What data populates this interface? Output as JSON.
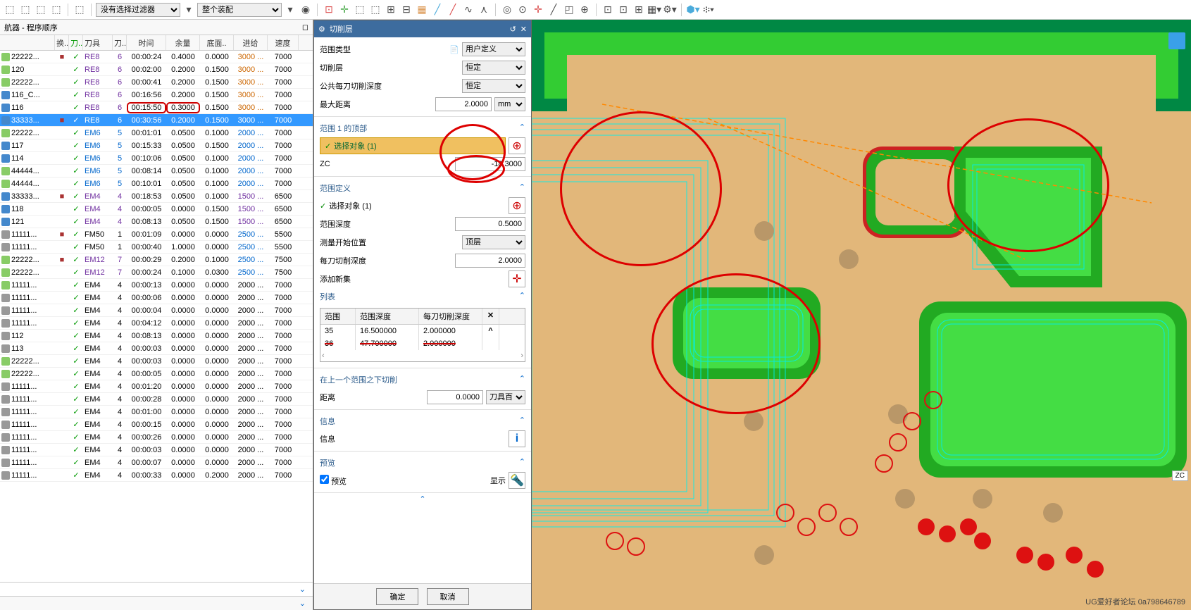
{
  "toolbar": {
    "filter1": "没有选择过滤器",
    "filter2": "整个装配"
  },
  "nav": {
    "title": "航器 - 程序顺序",
    "cols": {
      "name": "",
      "huan": "换..",
      "dao": "刀..",
      "tool": "刀具",
      "d": "刀..",
      "time": "时间",
      "yl": "余量",
      "dm": "底面..",
      "feed": "进给",
      "speed": "速度"
    },
    "rows": [
      {
        "ic": "op1",
        "name": "22222...",
        "huan": "■",
        "tool": "RE8",
        "d": "6",
        "time": "00:00:24",
        "yl": "0.4000",
        "dm": "0.0000",
        "feed": "3000 ...",
        "speed": "7000",
        "tc": "purple",
        "fc": "orange"
      },
      {
        "ic": "op1",
        "name": "120",
        "tool": "RE8",
        "d": "6",
        "time": "00:02:00",
        "yl": "0.2000",
        "dm": "0.1500",
        "feed": "3000 ...",
        "speed": "7000",
        "tc": "purple",
        "fc": "orange"
      },
      {
        "ic": "op1",
        "name": "22222...",
        "tool": "RE8",
        "d": "6",
        "time": "00:00:41",
        "yl": "0.2000",
        "dm": "0.1500",
        "feed": "3000 ...",
        "speed": "7000",
        "tc": "purple",
        "fc": "orange"
      },
      {
        "ic": "op2",
        "name": "116_C...",
        "tool": "RE8",
        "d": "6",
        "time": "00:16:56",
        "yl": "0.2000",
        "dm": "0.1500",
        "feed": "3000 ...",
        "speed": "7000",
        "tc": "purple",
        "fc": "orange"
      },
      {
        "ic": "op2",
        "name": "116",
        "tool": "RE8",
        "d": "6",
        "time": "00:15:50",
        "yl": "0.3000",
        "dm": "0.1500",
        "feed": "3000 ...",
        "speed": "7000",
        "tc": "purple",
        "fc": "orange",
        "hl": true
      },
      {
        "ic": "op2",
        "name": "33333...",
        "huan": "■",
        "tool": "RE8",
        "d": "6",
        "time": "00:30:56",
        "yl": "0.2000",
        "dm": "0.1500",
        "feed": "3000 ...",
        "speed": "7000",
        "sel": true
      },
      {
        "ic": "op1",
        "name": "22222...",
        "tool": "EM6",
        "d": "5",
        "time": "00:01:01",
        "yl": "0.0500",
        "dm": "0.1000",
        "feed": "2000 ...",
        "speed": "7000",
        "tc": "blue",
        "fc": "blue"
      },
      {
        "ic": "op2",
        "name": "117",
        "tool": "EM6",
        "d": "5",
        "time": "00:15:33",
        "yl": "0.0500",
        "dm": "0.1500",
        "feed": "2000 ...",
        "speed": "7000",
        "tc": "blue",
        "fc": "blue"
      },
      {
        "ic": "op2",
        "name": "114",
        "tool": "EM6",
        "d": "5",
        "time": "00:10:06",
        "yl": "0.0500",
        "dm": "0.1000",
        "feed": "2000 ...",
        "speed": "7000",
        "tc": "blue",
        "fc": "blue"
      },
      {
        "ic": "op1",
        "name": "44444...",
        "tool": "EM6",
        "d": "5",
        "time": "00:08:14",
        "yl": "0.0500",
        "dm": "0.1000",
        "feed": "2000 ...",
        "speed": "7000",
        "tc": "blue",
        "fc": "blue"
      },
      {
        "ic": "op1",
        "name": "44444...",
        "tool": "EM6",
        "d": "5",
        "time": "00:10:01",
        "yl": "0.0500",
        "dm": "0.1000",
        "feed": "2000 ...",
        "speed": "7000",
        "tc": "blue",
        "fc": "blue"
      },
      {
        "ic": "op2",
        "name": "33333...",
        "huan": "■",
        "tool": "EM4",
        "d": "4",
        "time": "00:18:53",
        "yl": "0.0500",
        "dm": "0.1000",
        "feed": "1500 ...",
        "speed": "6500",
        "tc": "purple",
        "fc": "purple"
      },
      {
        "ic": "op2",
        "name": "118",
        "tool": "EM4",
        "d": "4",
        "time": "00:00:05",
        "yl": "0.0000",
        "dm": "0.1500",
        "feed": "1500 ...",
        "speed": "6500",
        "tc": "purple",
        "fc": "purple"
      },
      {
        "ic": "op2",
        "name": "121",
        "tool": "EM4",
        "d": "4",
        "time": "00:08:13",
        "yl": "0.0500",
        "dm": "0.1500",
        "feed": "1500 ...",
        "speed": "6500",
        "tc": "purple",
        "fc": "purple"
      },
      {
        "ic": "op3",
        "name": "11111...",
        "huan": "■",
        "tool": "FM50",
        "d": "1",
        "time": "00:01:09",
        "yl": "0.0000",
        "dm": "0.0000",
        "feed": "2500 ...",
        "speed": "5500",
        "fc": "blue"
      },
      {
        "ic": "op3",
        "name": "11111...",
        "tool": "FM50",
        "d": "1",
        "time": "00:00:40",
        "yl": "1.0000",
        "dm": "0.0000",
        "feed": "2500 ...",
        "speed": "5500",
        "fc": "blue"
      },
      {
        "ic": "op1",
        "name": "22222...",
        "huan": "■",
        "tool": "EM12",
        "d": "7",
        "time": "00:00:29",
        "yl": "0.2000",
        "dm": "0.1000",
        "feed": "2500 ...",
        "speed": "7500",
        "tc": "purple",
        "fc": "blue"
      },
      {
        "ic": "op1",
        "name": "22222...",
        "tool": "EM12",
        "d": "7",
        "time": "00:00:24",
        "yl": "0.1000",
        "dm": "0.0300",
        "feed": "2500 ...",
        "speed": "7500",
        "tc": "purple",
        "fc": "blue"
      },
      {
        "ic": "op1",
        "name": "11111...",
        "tool": "EM4",
        "d": "4",
        "time": "00:00:13",
        "yl": "0.0000",
        "dm": "0.0000",
        "feed": "2000 ...",
        "speed": "7000"
      },
      {
        "ic": "op3",
        "name": "11111...",
        "tool": "EM4",
        "d": "4",
        "time": "00:00:06",
        "yl": "0.0000",
        "dm": "0.0000",
        "feed": "2000 ...",
        "speed": "7000"
      },
      {
        "ic": "op3",
        "name": "11111...",
        "tool": "EM4",
        "d": "4",
        "time": "00:00:04",
        "yl": "0.0000",
        "dm": "0.0000",
        "feed": "2000 ...",
        "speed": "7000"
      },
      {
        "ic": "op3",
        "name": "11111...",
        "tool": "EM4",
        "d": "4",
        "time": "00:04:12",
        "yl": "0.0000",
        "dm": "0.0000",
        "feed": "2000 ...",
        "speed": "7000"
      },
      {
        "ic": "op3",
        "name": "112",
        "tool": "EM4",
        "d": "4",
        "time": "00:08:13",
        "yl": "0.0000",
        "dm": "0.0000",
        "feed": "2000 ...",
        "speed": "7000"
      },
      {
        "ic": "op3",
        "name": "113",
        "tool": "EM4",
        "d": "4",
        "time": "00:00:03",
        "yl": "0.0000",
        "dm": "0.0000",
        "feed": "2000 ...",
        "speed": "7000"
      },
      {
        "ic": "op1",
        "name": "22222...",
        "tool": "EM4",
        "d": "4",
        "time": "00:00:03",
        "yl": "0.0000",
        "dm": "0.0000",
        "feed": "2000 ...",
        "speed": "7000"
      },
      {
        "ic": "op1",
        "name": "22222...",
        "tool": "EM4",
        "d": "4",
        "time": "00:00:05",
        "yl": "0.0000",
        "dm": "0.0000",
        "feed": "2000 ...",
        "speed": "7000"
      },
      {
        "ic": "op3",
        "name": "11111...",
        "tool": "EM4",
        "d": "4",
        "time": "00:01:20",
        "yl": "0.0000",
        "dm": "0.0000",
        "feed": "2000 ...",
        "speed": "7000"
      },
      {
        "ic": "op3",
        "name": "11111...",
        "tool": "EM4",
        "d": "4",
        "time": "00:00:28",
        "yl": "0.0000",
        "dm": "0.0000",
        "feed": "2000 ...",
        "speed": "7000"
      },
      {
        "ic": "op3",
        "name": "11111...",
        "tool": "EM4",
        "d": "4",
        "time": "00:01:00",
        "yl": "0.0000",
        "dm": "0.0000",
        "feed": "2000 ...",
        "speed": "7000"
      },
      {
        "ic": "op3",
        "name": "11111...",
        "tool": "EM4",
        "d": "4",
        "time": "00:00:15",
        "yl": "0.0000",
        "dm": "0.0000",
        "feed": "2000 ...",
        "speed": "7000"
      },
      {
        "ic": "op3",
        "name": "11111...",
        "tool": "EM4",
        "d": "4",
        "time": "00:00:26",
        "yl": "0.0000",
        "dm": "0.0000",
        "feed": "2000 ...",
        "speed": "7000"
      },
      {
        "ic": "op3",
        "name": "11111...",
        "tool": "EM4",
        "d": "4",
        "time": "00:00:03",
        "yl": "0.0000",
        "dm": "0.0000",
        "feed": "2000 ...",
        "speed": "7000"
      },
      {
        "ic": "op3",
        "name": "11111...",
        "tool": "EM4",
        "d": "4",
        "time": "00:00:07",
        "yl": "0.0000",
        "dm": "0.0000",
        "feed": "2000 ...",
        "speed": "7000"
      },
      {
        "ic": "op3",
        "name": "11111...",
        "tool": "EM4",
        "d": "4",
        "time": "00:00:33",
        "yl": "0.0000",
        "dm": "0.2000",
        "feed": "2000 ...",
        "speed": "7000"
      }
    ]
  },
  "dlg": {
    "title": "切削层",
    "sec_type": {
      "h": "范围类型",
      "v": "用户定义"
    },
    "sec_layer": {
      "h": "切削层",
      "v": "恒定"
    },
    "sec_depth": {
      "h": "公共每刀切削深度",
      "v": "恒定"
    },
    "sec_maxdist": {
      "h": "最大距离",
      "v": "2.0000",
      "u": "mm"
    },
    "sec_r1": {
      "h": "范围 1 的顶部",
      "sel": "选择对象 (1)",
      "zc_l": "ZC",
      "zc_v": "-18.3000"
    },
    "sec_def": {
      "h": "范围定义",
      "sel": "选择对象 (1)",
      "rd_l": "范围深度",
      "rd_v": "0.5000",
      "mp_l": "测量开始位置",
      "mp_v": "顶层",
      "ed_l": "每刀切削深度",
      "ed_v": "2.0000",
      "add": "添加新集",
      "tbl_h": "列表",
      "tbl": {
        "c1": "范围",
        "c2": "范围深度",
        "c3": "每刀切削深度",
        "rows": [
          {
            "a": "35",
            "b": "16.500000",
            "c": "2.000000"
          },
          {
            "a": "36",
            "b": "47.700000",
            "c": "2.000000",
            "strike": true
          }
        ]
      }
    },
    "sec_below": {
      "h": "在上一个范围之下切削",
      "dl": "距离",
      "dv": "0.0000",
      "du": "刀具百"
    },
    "sec_info": {
      "h": "信息",
      "l": "信息"
    },
    "sec_prev": {
      "h": "预览",
      "cb": "预览",
      "btn": "显示"
    },
    "ok": "确定",
    "cancel": "取消"
  },
  "vp": {
    "watermark": "UG爱好者论坛 0a798646789",
    "zc": "ZC"
  }
}
